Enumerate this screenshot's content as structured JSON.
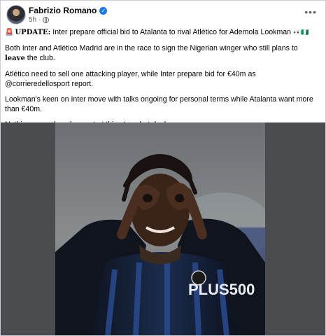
{
  "post": {
    "author": "Fabrizio Romano",
    "time": "5h",
    "more_label": "•••",
    "verified_mark": "✓",
    "lines": {
      "update_label": "UPDATE:",
      "headline": " Inter prepare official bid to Atalanta to rival Atlético for Ademola Lookman ",
      "headline_flags": "🇳🇬",
      "p2_a": "Both Inter and Atlético Madrid are in the race to sign the Nigerian winger who still plans to ",
      "p2_bold": "leave",
      "p2_b": " the club.",
      "p3": "Atlético need to sell one attacking player, while Inter prepare bid for €40m as @corrieredellosport report.",
      "p4": "Lookman's keen on Inter move with talks ongoing for personal terms while Atalanta want more than €40m.",
      "p5": "Nothing agreed or close yet at this stage but deal on."
    },
    "photo": {
      "jersey_text": "PLUS500"
    }
  },
  "colors": {
    "accent": "#1877f2",
    "meta_text": "#65676b",
    "photo_bg": "#4a4c50"
  },
  "icons": [
    "verified-badge-icon",
    "globe-icon",
    "more-options-icon",
    "siren-icon"
  ]
}
